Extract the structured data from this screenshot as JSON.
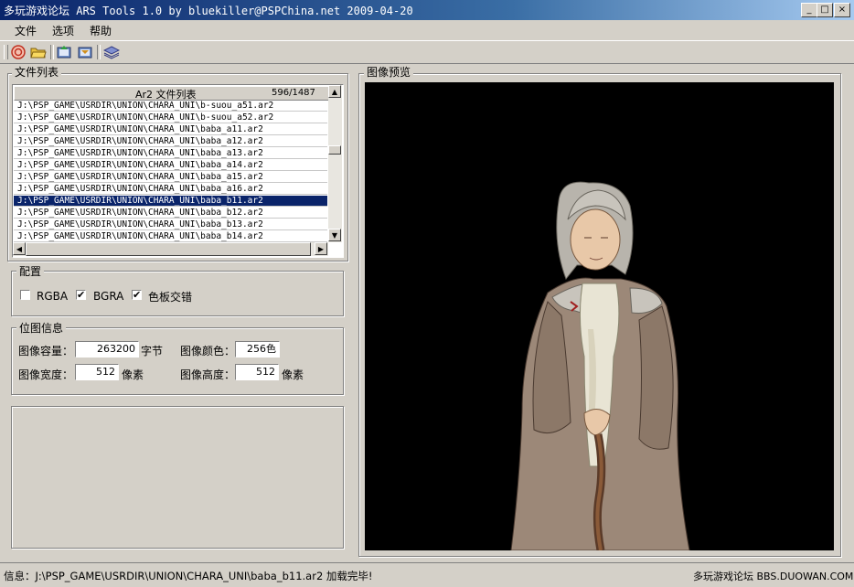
{
  "window": {
    "title": "多玩游戏论坛 ARS Tools 1.0 by bluekiller@PSPChina.net   2009-04-20",
    "minimize": "_",
    "maximize": "□",
    "close": "×"
  },
  "menu": [
    "文件",
    "选项",
    "帮助"
  ],
  "toolbar": {
    "icons": [
      "stop-icon",
      "open-folder-icon",
      "export-icon",
      "import-icon",
      "layers-icon"
    ]
  },
  "file_list": {
    "group_label": "文件列表",
    "header": "Ar2 文件列表",
    "count": "596/1487",
    "rows": [
      "J:\\PSP_GAME\\USRDIR\\UNION\\CHARA_UNI\\b-suou_a51.ar2",
      "J:\\PSP_GAME\\USRDIR\\UNION\\CHARA_UNI\\b-suou_a52.ar2",
      "J:\\PSP_GAME\\USRDIR\\UNION\\CHARA_UNI\\baba_a11.ar2",
      "J:\\PSP_GAME\\USRDIR\\UNION\\CHARA_UNI\\baba_a12.ar2",
      "J:\\PSP_GAME\\USRDIR\\UNION\\CHARA_UNI\\baba_a13.ar2",
      "J:\\PSP_GAME\\USRDIR\\UNION\\CHARA_UNI\\baba_a14.ar2",
      "J:\\PSP_GAME\\USRDIR\\UNION\\CHARA_UNI\\baba_a15.ar2",
      "J:\\PSP_GAME\\USRDIR\\UNION\\CHARA_UNI\\baba_a16.ar2",
      "J:\\PSP_GAME\\USRDIR\\UNION\\CHARA_UNI\\baba_b11.ar2",
      "J:\\PSP_GAME\\USRDIR\\UNION\\CHARA_UNI\\baba_b12.ar2",
      "J:\\PSP_GAME\\USRDIR\\UNION\\CHARA_UNI\\baba_b13.ar2",
      "J:\\PSP_GAME\\USRDIR\\UNION\\CHARA_UNI\\baba_b14.ar2"
    ],
    "selected_index": 8
  },
  "config": {
    "group_label": "配置",
    "options": [
      {
        "label": "RGBA",
        "checked": false
      },
      {
        "label": "BGRA",
        "checked": true
      },
      {
        "label": "色板交错",
        "checked": true
      }
    ]
  },
  "bitmap_info": {
    "group_label": "位图信息",
    "size_label": "图像容量：",
    "size_value": "263200",
    "size_unit": "字节",
    "color_label": "图像颜色：",
    "color_value": "256色",
    "width_label": "图像宽度：",
    "width_value": "512",
    "width_unit": "像素",
    "height_label": "图像高度：",
    "height_value": "512",
    "height_unit": "像素"
  },
  "preview": {
    "group_label": "图像预览"
  },
  "status": {
    "message": "信息：J:\\PSP_GAME\\USRDIR\\UNION\\CHARA_UNI\\baba_b11.ar2 加载完毕!",
    "watermark": "多玩游戏论坛 BBS.DUOWAN.COM"
  }
}
